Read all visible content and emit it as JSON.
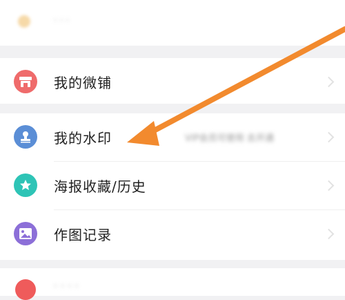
{
  "top": {
    "partial_text": "· · ·"
  },
  "menu": {
    "store_label": "我的微铺",
    "watermark_label": "我的水印",
    "watermark_hint": "VIP会员可使用  去开通",
    "poster_label": "海报收藏/历史",
    "record_label": "作图记录",
    "bottom_label": "· · · ·"
  },
  "colors": {
    "store_icon": "#ef6b6b",
    "watermark_icon": "#5b8ed6",
    "poster_icon": "#2ec4b6",
    "record_icon": "#8c6fd8",
    "arrow": "#f28a2e",
    "bottom_icon": "#ef5b5b"
  },
  "icons": {
    "store": "store-icon",
    "watermark": "stamp-icon",
    "poster": "star-icon",
    "record": "image-icon"
  }
}
